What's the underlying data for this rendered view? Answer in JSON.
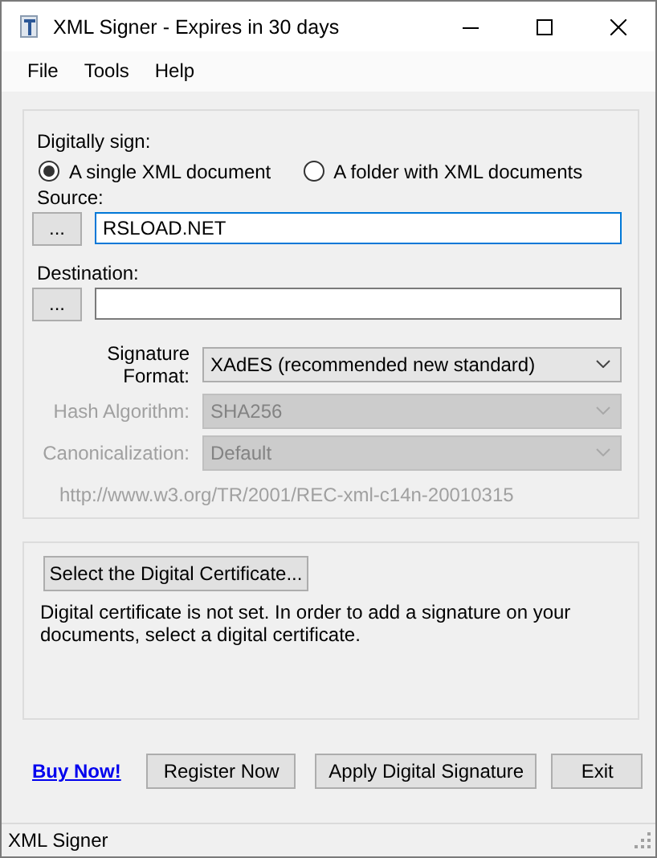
{
  "window": {
    "title": "XML Signer - Expires in 30 days"
  },
  "menu": [
    "File",
    "Tools",
    "Help"
  ],
  "sign": {
    "label": "Digitally sign:",
    "modes": [
      {
        "label": "A single XML document",
        "selected": true
      },
      {
        "label": "A folder with XML documents",
        "selected": false
      }
    ],
    "source": {
      "label": "Source:",
      "browse": "...",
      "value": "RSLOAD.NET"
    },
    "destination": {
      "label": "Destination:",
      "browse": "..."
    },
    "options": [
      {
        "label": "Signature Format:",
        "value": "XAdES (recommended new standard)",
        "disabled": false
      },
      {
        "label": "Hash Algorithm:",
        "value": "SHA256",
        "disabled": true
      },
      {
        "label": "Canonicalization:",
        "value": "Default",
        "disabled": true
      }
    ],
    "canonicalization_uri": "http://www.w3.org/TR/2001/REC-xml-c14n-20010315"
  },
  "certificate": {
    "button": "Select the Digital Certificate...",
    "message": "Digital certificate is not set. In order to add a signature on your documents, select a digital certificate."
  },
  "actions": {
    "link": "Buy Now!",
    "buttons": [
      "Register Now",
      "Apply Digital Signature",
      "Exit"
    ]
  },
  "status_bar": "XML Signer"
}
